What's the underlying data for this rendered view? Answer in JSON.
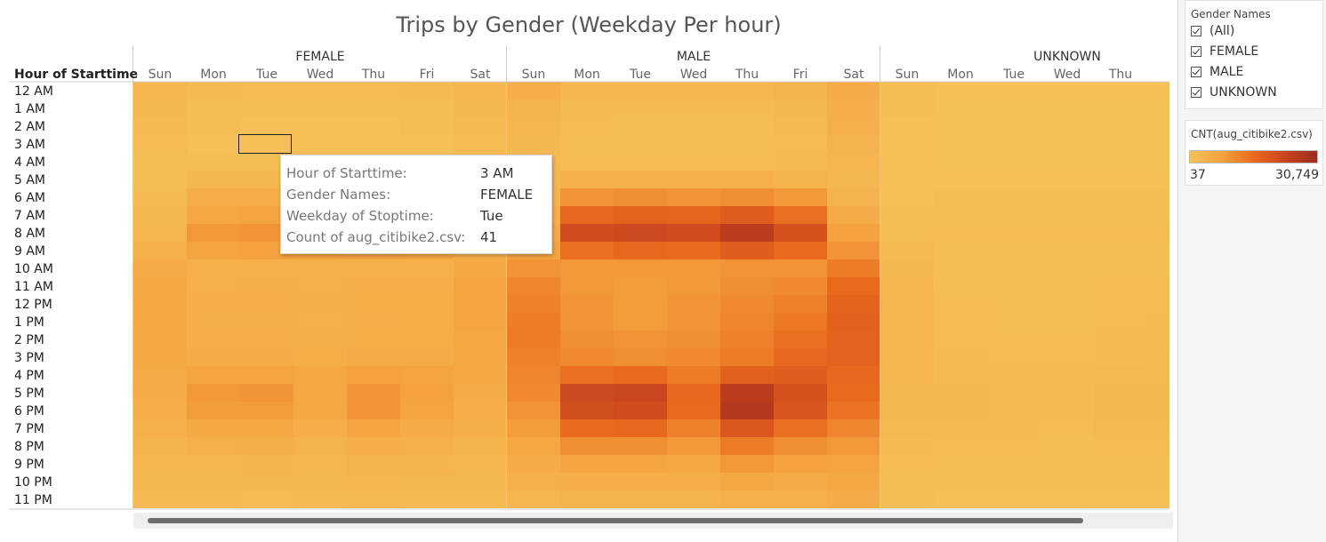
{
  "colors": {
    "scale": [
      "#f6c15a",
      "#f4a340",
      "#ea6a1d",
      "#c9441f",
      "#9c2c1d"
    ],
    "base": "#f5cd62",
    "grid_sep": "#cfcfcf",
    "highlight_border": "#222222"
  },
  "chart_data": {
    "type": "heatmap",
    "title": "Trips by Gender (Weekday Per hour)",
    "row_header": "Hour of Starttime",
    "rows": [
      "12 AM",
      "1 AM",
      "2 AM",
      "3 AM",
      "4 AM",
      "5 AM",
      "6 AM",
      "7 AM",
      "8 AM",
      "9 AM",
      "10 AM",
      "11 AM",
      "12 PM",
      "1 PM",
      "2 PM",
      "3 PM",
      "4 PM",
      "5 PM",
      "6 PM",
      "7 PM",
      "8 PM",
      "9 PM",
      "10 PM",
      "11 PM"
    ],
    "groups": [
      "FEMALE",
      "MALE",
      "UNKNOWN"
    ],
    "days": [
      "Sun",
      "Mon",
      "Tue",
      "Wed",
      "Thu",
      "Fri",
      "Sat"
    ],
    "visible_columns": [
      7,
      7,
      6
    ],
    "value_range": [
      37,
      30749
    ],
    "highlighted": {
      "group": 0,
      "day": 2,
      "row": 3
    },
    "intensity": [
      [
        [
          0.1,
          0.06,
          0.05,
          0.05,
          0.05,
          0.06,
          0.1
        ],
        [
          0.08,
          0.04,
          0.03,
          0.03,
          0.03,
          0.04,
          0.08
        ],
        [
          0.06,
          0.03,
          0.02,
          0.02,
          0.02,
          0.03,
          0.06
        ],
        [
          0.05,
          0.02,
          0.02,
          0.02,
          0.02,
          0.02,
          0.05
        ],
        [
          0.04,
          0.03,
          0.03,
          0.03,
          0.03,
          0.03,
          0.04
        ],
        [
          0.04,
          0.08,
          0.08,
          0.08,
          0.08,
          0.07,
          0.04
        ],
        [
          0.06,
          0.16,
          0.16,
          0.15,
          0.16,
          0.14,
          0.06
        ],
        [
          0.08,
          0.22,
          0.24,
          0.23,
          0.22,
          0.2,
          0.09
        ],
        [
          0.1,
          0.3,
          0.32,
          0.31,
          0.3,
          0.27,
          0.12
        ],
        [
          0.14,
          0.24,
          0.26,
          0.25,
          0.24,
          0.22,
          0.15
        ],
        [
          0.18,
          0.14,
          0.14,
          0.14,
          0.14,
          0.14,
          0.2
        ],
        [
          0.21,
          0.14,
          0.15,
          0.14,
          0.16,
          0.16,
          0.23
        ],
        [
          0.22,
          0.16,
          0.16,
          0.15,
          0.17,
          0.17,
          0.24
        ],
        [
          0.22,
          0.15,
          0.15,
          0.14,
          0.16,
          0.17,
          0.23
        ],
        [
          0.21,
          0.16,
          0.16,
          0.15,
          0.17,
          0.17,
          0.22
        ],
        [
          0.21,
          0.18,
          0.18,
          0.17,
          0.19,
          0.19,
          0.22
        ],
        [
          0.19,
          0.23,
          0.24,
          0.22,
          0.26,
          0.24,
          0.2
        ],
        [
          0.18,
          0.3,
          0.31,
          0.22,
          0.32,
          0.26,
          0.18
        ],
        [
          0.16,
          0.28,
          0.28,
          0.2,
          0.32,
          0.24,
          0.16
        ],
        [
          0.14,
          0.2,
          0.21,
          0.16,
          0.23,
          0.18,
          0.15
        ],
        [
          0.12,
          0.14,
          0.15,
          0.12,
          0.16,
          0.14,
          0.12
        ],
        [
          0.1,
          0.1,
          0.11,
          0.1,
          0.12,
          0.11,
          0.1
        ],
        [
          0.08,
          0.08,
          0.08,
          0.08,
          0.09,
          0.08,
          0.08
        ],
        [
          0.06,
          0.06,
          0.05,
          0.06,
          0.07,
          0.06,
          0.06
        ]
      ],
      [
        [
          0.16,
          0.1,
          0.1,
          0.1,
          0.1,
          0.12,
          0.18
        ],
        [
          0.12,
          0.06,
          0.06,
          0.06,
          0.06,
          0.08,
          0.16
        ],
        [
          0.1,
          0.05,
          0.04,
          0.04,
          0.04,
          0.06,
          0.14
        ],
        [
          0.08,
          0.04,
          0.04,
          0.04,
          0.04,
          0.05,
          0.12
        ],
        [
          0.07,
          0.05,
          0.05,
          0.05,
          0.05,
          0.06,
          0.09
        ],
        [
          0.08,
          0.14,
          0.14,
          0.14,
          0.14,
          0.12,
          0.08
        ],
        [
          0.1,
          0.32,
          0.34,
          0.32,
          0.34,
          0.3,
          0.12
        ],
        [
          0.14,
          0.52,
          0.54,
          0.53,
          0.58,
          0.48,
          0.18
        ],
        [
          0.18,
          0.7,
          0.72,
          0.7,
          0.82,
          0.66,
          0.26
        ],
        [
          0.24,
          0.48,
          0.52,
          0.5,
          0.58,
          0.5,
          0.32
        ],
        [
          0.32,
          0.3,
          0.3,
          0.3,
          0.32,
          0.32,
          0.42
        ],
        [
          0.38,
          0.3,
          0.28,
          0.3,
          0.34,
          0.36,
          0.5
        ],
        [
          0.4,
          0.32,
          0.28,
          0.32,
          0.36,
          0.4,
          0.54
        ],
        [
          0.42,
          0.32,
          0.28,
          0.32,
          0.38,
          0.44,
          0.56
        ],
        [
          0.42,
          0.34,
          0.32,
          0.34,
          0.4,
          0.48,
          0.55
        ],
        [
          0.4,
          0.36,
          0.34,
          0.36,
          0.42,
          0.52,
          0.55
        ],
        [
          0.38,
          0.48,
          0.5,
          0.42,
          0.56,
          0.58,
          0.52
        ],
        [
          0.36,
          0.72,
          0.74,
          0.52,
          0.82,
          0.66,
          0.5
        ],
        [
          0.32,
          0.68,
          0.7,
          0.5,
          0.86,
          0.64,
          0.46
        ],
        [
          0.28,
          0.5,
          0.52,
          0.4,
          0.62,
          0.48,
          0.38
        ],
        [
          0.22,
          0.34,
          0.34,
          0.3,
          0.42,
          0.34,
          0.3
        ],
        [
          0.18,
          0.24,
          0.24,
          0.22,
          0.3,
          0.25,
          0.24
        ],
        [
          0.14,
          0.16,
          0.16,
          0.16,
          0.2,
          0.18,
          0.2
        ],
        [
          0.1,
          0.12,
          0.12,
          0.12,
          0.14,
          0.14,
          0.18
        ]
      ],
      [
        [
          0.04,
          0.02,
          0.02,
          0.02,
          0.02,
          0.02
        ],
        [
          0.03,
          0.01,
          0.01,
          0.01,
          0.01,
          0.01
        ],
        [
          0.02,
          0.01,
          0.01,
          0.01,
          0.01,
          0.01
        ],
        [
          0.02,
          0.01,
          0.01,
          0.01,
          0.01,
          0.01
        ],
        [
          0.02,
          0.01,
          0.01,
          0.01,
          0.01,
          0.01
        ],
        [
          0.02,
          0.02,
          0.02,
          0.02,
          0.02,
          0.02
        ],
        [
          0.02,
          0.03,
          0.03,
          0.03,
          0.03,
          0.03
        ],
        [
          0.03,
          0.04,
          0.04,
          0.04,
          0.04,
          0.04
        ],
        [
          0.04,
          0.05,
          0.05,
          0.05,
          0.05,
          0.05
        ],
        [
          0.06,
          0.04,
          0.04,
          0.04,
          0.04,
          0.04
        ],
        [
          0.08,
          0.04,
          0.04,
          0.04,
          0.04,
          0.04
        ],
        [
          0.09,
          0.04,
          0.04,
          0.04,
          0.05,
          0.05
        ],
        [
          0.1,
          0.05,
          0.04,
          0.04,
          0.05,
          0.05
        ],
        [
          0.1,
          0.05,
          0.04,
          0.04,
          0.05,
          0.06
        ],
        [
          0.1,
          0.05,
          0.05,
          0.05,
          0.06,
          0.06
        ],
        [
          0.1,
          0.06,
          0.05,
          0.05,
          0.06,
          0.07
        ],
        [
          0.09,
          0.06,
          0.06,
          0.06,
          0.07,
          0.07
        ],
        [
          0.08,
          0.08,
          0.07,
          0.06,
          0.08,
          0.08
        ],
        [
          0.08,
          0.08,
          0.07,
          0.06,
          0.08,
          0.08
        ],
        [
          0.07,
          0.06,
          0.06,
          0.05,
          0.07,
          0.07
        ],
        [
          0.06,
          0.05,
          0.05,
          0.04,
          0.05,
          0.05
        ],
        [
          0.05,
          0.04,
          0.04,
          0.04,
          0.04,
          0.04
        ],
        [
          0.04,
          0.03,
          0.03,
          0.03,
          0.03,
          0.03
        ],
        [
          0.03,
          0.02,
          0.02,
          0.02,
          0.02,
          0.02
        ]
      ]
    ]
  },
  "filter": {
    "title": "Gender Names",
    "items": [
      "(All)",
      "FEMALE",
      "MALE",
      "UNKNOWN"
    ]
  },
  "legend": {
    "title": "CNT(aug_citibike2.csv)",
    "min": "37",
    "max": "30,749"
  },
  "tooltip": {
    "rows": [
      {
        "label": "Hour of Starttime:",
        "value": "3 AM"
      },
      {
        "label": "Gender Names:",
        "value": "FEMALE"
      },
      {
        "label": "Weekday of Stoptime:",
        "value": "Tue"
      },
      {
        "label": "Count of aug_citibike2.csv:",
        "value": "41"
      }
    ]
  }
}
